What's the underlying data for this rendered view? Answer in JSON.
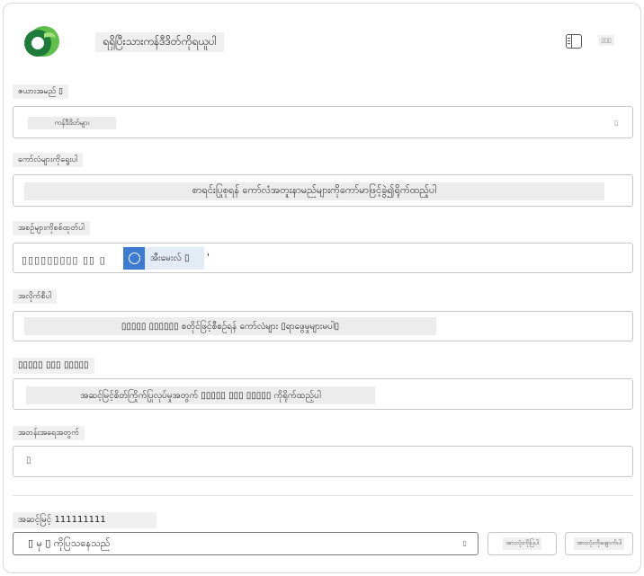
{
  "header": {
    "title": "ရရှိပြီးသားကန်ဒီဒိတ်ကိုရယူပါ",
    "corner_text": "▯▯▯"
  },
  "fields": {
    "table": {
      "label": "ဇယားအမည် ▯",
      "value": "ကန်ဒီဒိတ်များ",
      "caret": "▯"
    },
    "columns": {
      "label": "ကော်လံများကိုရွေးပါ",
      "value": "စာရင်းပြုစုရန် ကော်လံအတူးနာမည်များကိုကော်မာဖြင့်ခွဲ၍ရိုက်ထည့်ပါ"
    },
    "sort": {
      "label": "အစဉ်များကိုစစ်ထုတ်ပါ",
      "value_prefix": "▯▯▯▯▯▯▯▯▯ ▯▯ ▯",
      "tag_label": "အီးမေးလ် ▯",
      "value_suffix": "'"
    },
    "filter": {
      "label": "အလိုက်စီပါ",
      "value": "▯▯▯▯▯ ▯▯▯▯▯▯ စတိုင်ဖြင့်စီစဉ်ရန် ကော်လံများ ▯ရာဖွေမှုများမပါ▯"
    },
    "expand": {
      "label": "▯▯▯▯▯ ▯▯▯ ▯▯▯▯▯",
      "value": "အဆင့်မြင့်စိတ်ကြိုက်ပြုလုပ်မှုအတွက် ▯▯▯▯▯ ▯▯▯ ▯▯▯▯▯ ကိုရိုက်ထည့်ပါ"
    },
    "rows": {
      "label": "အတန်းအရေအတွက်",
      "value": "▯"
    }
  },
  "footer": {
    "advanced_label": "အဆင့်မြင့် 111111111",
    "dropdown_value": "▯ မှ ▯ ကိုပြသနေသည်",
    "dropdown_caret": "▯",
    "button_1": "အားလုံးကိုပြပါ",
    "button_2": "အားလုံးကိုဖျောက်ပါ"
  },
  "colors": {
    "logo_dark": "#1e7b3a",
    "logo_light": "#6cc24a",
    "tag_icon": "#3b7bd1"
  }
}
